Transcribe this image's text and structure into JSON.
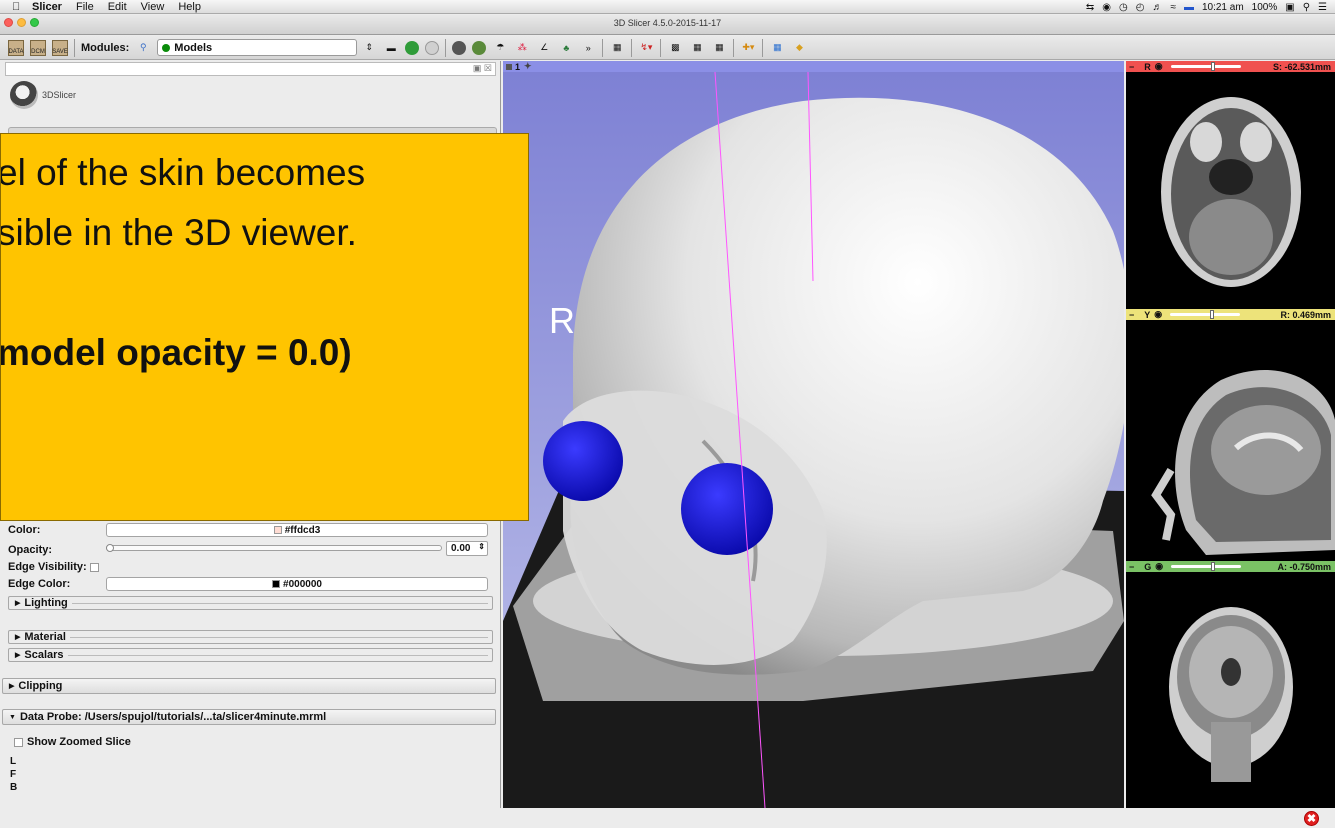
{
  "menubar": {
    "app": "Slicer",
    "items": [
      "File",
      "Edit",
      "View",
      "Help"
    ],
    "clock": "10:21 am",
    "battery": "100%"
  },
  "window": {
    "title": "3D Slicer 4.5.0-2015-11-17"
  },
  "toolbar": {
    "data_label": "DATA",
    "dcm_label": "DCM",
    "save_label": "SAVE",
    "modules_label": "Modules:",
    "module_selected": "Models"
  },
  "left_panel": {
    "logo_text": "3DSlicer",
    "color_label": "Color:",
    "color_value": "#ffdcd3",
    "opacity_label": "Opacity:",
    "opacity_value": "0.00",
    "edge_visibility_label": "Edge Visibility:",
    "edge_color_label": "Edge Color:",
    "edge_color_value": "#000000",
    "sections": [
      "Lighting",
      "Material",
      "Scalars"
    ],
    "clipping_label": "Clipping",
    "data_probe_label": "Data Probe: /Users/spujol/tutorials/...ta/slicer4minute.mrml",
    "show_zoomed_label": "Show Zoomed Slice",
    "probe_lines": [
      "L",
      "F",
      "B"
    ]
  },
  "view3d": {
    "label": "1",
    "orientation_marker": "R"
  },
  "slices": [
    {
      "letter": "R",
      "value": "S: -62.531mm",
      "color": "#f0514f"
    },
    {
      "letter": "Y",
      "value": "R: 0.469mm",
      "color": "#ede37a"
    },
    {
      "letter": "G",
      "value": "A: -0.750mm",
      "color": "#7ac265"
    }
  ],
  "overlay": {
    "line1": "el of the skin becomes",
    "line2": "sible in the 3D viewer.",
    "line3": " model opacity = 0.0)"
  },
  "colors": {
    "overlay_bg": "#ffc400",
    "view3d_bg": "#8b8fe6",
    "eyes": "#1010d8"
  }
}
